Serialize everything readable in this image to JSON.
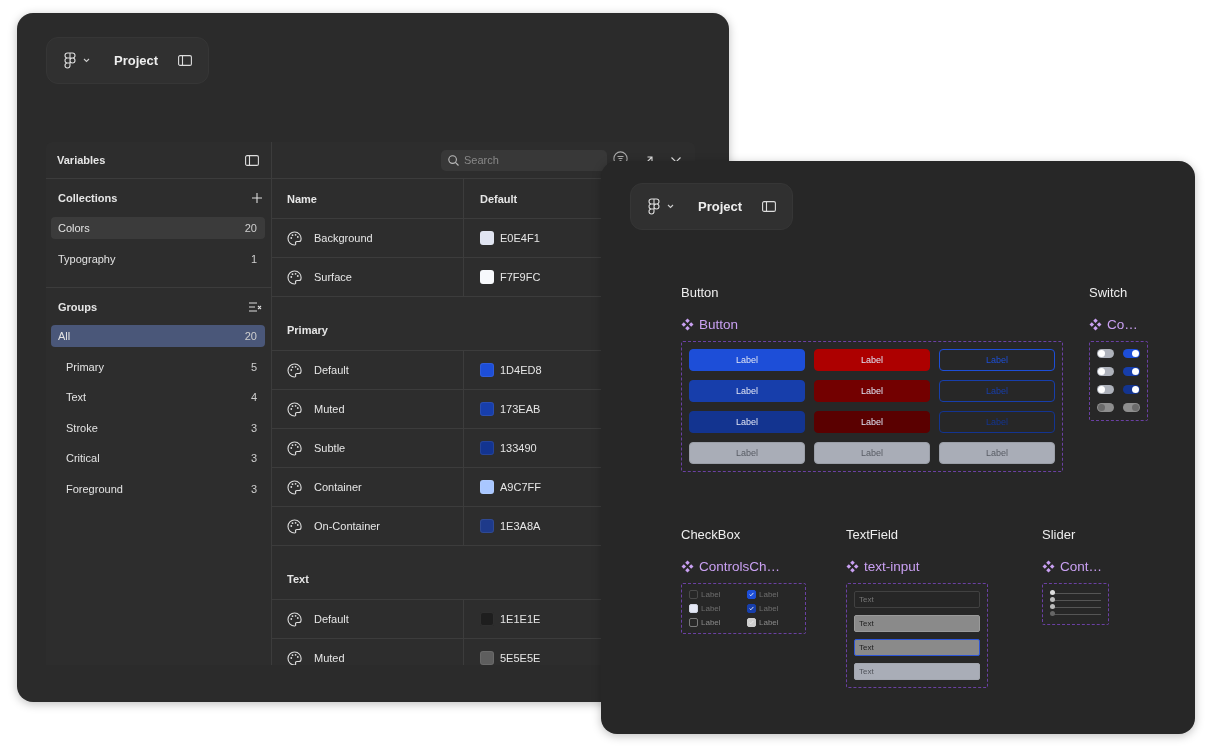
{
  "back_window": {
    "header": {
      "title": "Project"
    },
    "panel": {
      "title": "Variables",
      "search": {
        "placeholder": "Search"
      },
      "collections": {
        "title": "Collections",
        "items": [
          {
            "label": "Colors",
            "count": "20",
            "selected": true
          },
          {
            "label": "Typography",
            "count": "1",
            "selected": false
          }
        ]
      },
      "groups": {
        "title": "Groups",
        "items": [
          {
            "label": "All",
            "count": "20",
            "selected": true,
            "children": [
              {
                "label": "Primary",
                "count": "5",
                "selected": false
              },
              {
                "label": "Text",
                "count": "4",
                "selected": false
              },
              {
                "label": "Stroke",
                "count": "3",
                "selected": false
              },
              {
                "label": "Critical",
                "count": "3",
                "selected": false
              },
              {
                "label": "Foreground",
                "count": "3",
                "selected": false
              }
            ]
          }
        ]
      },
      "table": {
        "columns": [
          "Name",
          "Default"
        ],
        "rows": [
          {
            "kind": "variable",
            "name": "Background",
            "value": "E0E4F1",
            "color": "#e0e4f1"
          },
          {
            "kind": "variable",
            "name": "Surface",
            "value": "F7F9FC",
            "color": "#f7f9fc"
          },
          {
            "kind": "section",
            "title": "Primary"
          },
          {
            "kind": "variable",
            "name": "Default",
            "value": "1D4ED8",
            "color": "#1d4ed8"
          },
          {
            "kind": "variable",
            "name": "Muted",
            "value": "173EAB",
            "color": "#173eab"
          },
          {
            "kind": "variable",
            "name": "Subtle",
            "value": "133490",
            "color": "#133490"
          },
          {
            "kind": "variable",
            "name": "Container",
            "value": "A9C7FF",
            "color": "#a9c7ff"
          },
          {
            "kind": "variable",
            "name": "On-Container",
            "value": "1E3A8A",
            "color": "#1e3a8a"
          },
          {
            "kind": "section",
            "title": "Text"
          },
          {
            "kind": "variable",
            "name": "Default",
            "value": "1E1E1E",
            "color": "#1e1e1e"
          },
          {
            "kind": "variable",
            "name": "Muted",
            "value": "5E5E5E",
            "color": "#5e5e5e"
          }
        ]
      }
    }
  },
  "front_window": {
    "header": {
      "title": "Project"
    },
    "component_rows": [
      {
        "components": [
          {
            "kind": "buttons",
            "title": "Button",
            "component": "Button",
            "buttons": [
              {
                "kind": "filled",
                "label": "Label",
                "color": "#1d4ed8",
                "disabled": false
              },
              {
                "kind": "filled",
                "label": "Label",
                "color": "#ad0000",
                "disabled": false
              },
              {
                "kind": "outline",
                "label": "Label",
                "color": "#1d4ed8",
                "disabled": false
              },
              {
                "kind": "filled",
                "label": "Label",
                "color": "#173eab",
                "disabled": false
              },
              {
                "kind": "filled",
                "label": "Label",
                "color": "#730000",
                "disabled": false
              },
              {
                "kind": "outline",
                "label": "Label",
                "color": "#173eab",
                "disabled": false
              },
              {
                "kind": "filled",
                "label": "Label",
                "color": "#133490",
                "disabled": false
              },
              {
                "kind": "filled",
                "label": "Label",
                "color": "#5a0000",
                "disabled": false
              },
              {
                "kind": "outline",
                "label": "Label",
                "color": "#133490",
                "disabled": false
              },
              {
                "kind": "filled",
                "label": "Label",
                "disabled": true
              },
              {
                "kind": "filled",
                "label": "Label",
                "disabled": true
              },
              {
                "kind": "filled",
                "label": "Label",
                "disabled": true
              }
            ]
          },
          {
            "kind": "switches",
            "title": "Switch",
            "component": "Co…",
            "switches": [
              {
                "on": false,
                "disabled": false
              },
              {
                "on": true,
                "disabled": false,
                "color": "#1d4ed8"
              },
              {
                "on": false,
                "disabled": false
              },
              {
                "on": true,
                "disabled": false,
                "color": "#173eab"
              },
              {
                "on": false,
                "disabled": false
              },
              {
                "on": true,
                "disabled": false,
                "color": "#133490"
              },
              {
                "on": false,
                "disabled": true
              },
              {
                "on": true,
                "disabled": true
              }
            ]
          }
        ]
      },
      {
        "components": [
          {
            "kind": "checkboxes",
            "title": "CheckBox",
            "component": "ControlsCh…",
            "checkboxes": [
              {
                "kind": "default",
                "label": "Label",
                "checked": false
              },
              {
                "kind": "default",
                "label": "Label",
                "checked": true,
                "color": "#1d4ed8"
              },
              {
                "kind": "hover",
                "label": "Label",
                "checked": false
              },
              {
                "kind": "hover",
                "label": "Label",
                "checked": true,
                "color": "#173eab"
              },
              {
                "kind": "disabled",
                "label": "Label",
                "checked": false
              },
              {
                "kind": "disabled",
                "label": "Label",
                "checked": true
              }
            ]
          },
          {
            "kind": "textfields",
            "title": "TextField",
            "component": "text-input",
            "fields": [
              {
                "placeholder": "Text",
                "focused": false,
                "disabled": false
              },
              {
                "value": "Text",
                "focused": false,
                "disabled": false
              },
              {
                "value": "Text",
                "focused": true,
                "disabled": false
              },
              {
                "value": "Text",
                "focused": false,
                "disabled": true
              }
            ]
          },
          {
            "kind": "sliders",
            "title": "Slider",
            "component": "Cont…",
            "sliders": [
              {
                "level": 0,
                "disabled": false
              },
              {
                "level": 0,
                "disabled": false
              },
              {
                "level": 0,
                "disabled": false
              },
              {
                "level": 0,
                "disabled": true
              }
            ]
          }
        ]
      }
    ]
  }
}
